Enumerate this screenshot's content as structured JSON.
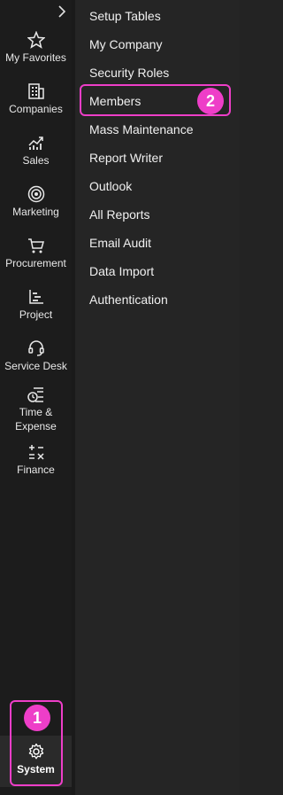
{
  "sidebar": {
    "items": [
      {
        "label": "My Favorites",
        "icon": "star-icon"
      },
      {
        "label": "Companies",
        "icon": "building-icon"
      },
      {
        "label": "Sales",
        "icon": "chart-icon"
      },
      {
        "label": "Marketing",
        "icon": "target-icon"
      },
      {
        "label": "Procurement",
        "icon": "cart-icon"
      },
      {
        "label": "Project",
        "icon": "project-chart-icon"
      },
      {
        "label": "Service Desk",
        "icon": "headset-icon"
      },
      {
        "label": "Time &",
        "label2": "Expense",
        "icon": "time-expense-icon"
      },
      {
        "label": "Finance",
        "icon": "calculator-icon"
      }
    ],
    "system": {
      "label": "System",
      "icon": "gear-icon"
    }
  },
  "submenu": {
    "items": [
      "Setup Tables",
      "My Company",
      "Security Roles",
      "Members",
      "Mass Maintenance",
      "Report Writer",
      "Outlook",
      "All Reports",
      "Email Audit",
      "Data Import",
      "Authentication"
    ]
  },
  "callouts": {
    "one": "1",
    "two": "2"
  },
  "colors": {
    "highlight": "#ee3ec8",
    "sidebar_bg": "#1c1c1c",
    "submenu_bg": "#252525"
  }
}
